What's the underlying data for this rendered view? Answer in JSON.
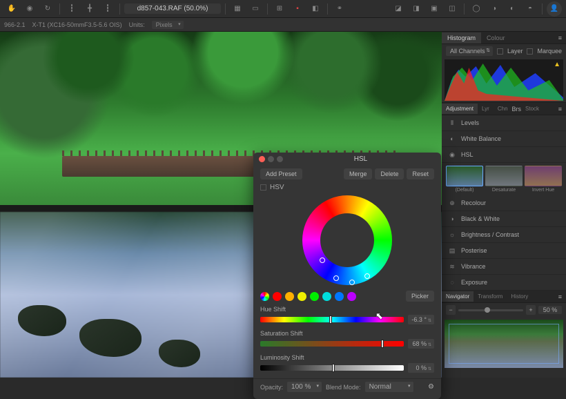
{
  "toolbar": {
    "filename": "d857-043.RAF (50.0%)"
  },
  "secondbar": {
    "camera_profile": "966-2.1",
    "lens_profile": "X-T1 (XC16-50mmF3.5-5.6 OIS)",
    "units_label": "Units:",
    "units_value": "Pixels"
  },
  "right": {
    "hist_tab": "Histogram",
    "colour_tab": "Colour",
    "channels": "All Channels",
    "layer_chk": "Layer",
    "marquee_chk": "Marquee",
    "adj_tabs": {
      "adjustment": "Adjustment",
      "lyr": "Lyr",
      "chn": "Chn",
      "brs": "Brs",
      "stock": "Stock"
    },
    "adjustments": {
      "levels": "Levels",
      "white_balance": "White Balance",
      "hsl": "HSL",
      "recolour": "Recolour",
      "black_white": "Black & White",
      "bright_contrast": "Brightness / Contrast",
      "posterise": "Posterise",
      "vibrance": "Vibrance",
      "exposure": "Exposure"
    },
    "thumbs": {
      "default": "(Default)",
      "desat": "Desaturate",
      "invert": "Invert Hue"
    },
    "nav_tabs": {
      "navigator": "Navigator",
      "transform": "Transform",
      "history": "History"
    },
    "zoom": "50 %"
  },
  "hsl": {
    "title": "HSL",
    "add_preset": "Add Preset",
    "merge": "Merge",
    "delete": "Delete",
    "reset": "Reset",
    "hsv": "HSV",
    "picker": "Picker",
    "hue_label": "Hue Shift",
    "hue_val": "-6.3 °",
    "sat_label": "Saturation Shift",
    "sat_val": "68 %",
    "lum_label": "Luminosity Shift",
    "lum_val": "0 %",
    "opacity_label": "Opacity:",
    "opacity_val": "100 %",
    "blend_label": "Blend Mode:",
    "blend_val": "Normal",
    "swatches": [
      "#f00",
      "#ffb000",
      "#ee0",
      "#0e0",
      "#0dd",
      "#07f",
      "#b0f"
    ]
  }
}
